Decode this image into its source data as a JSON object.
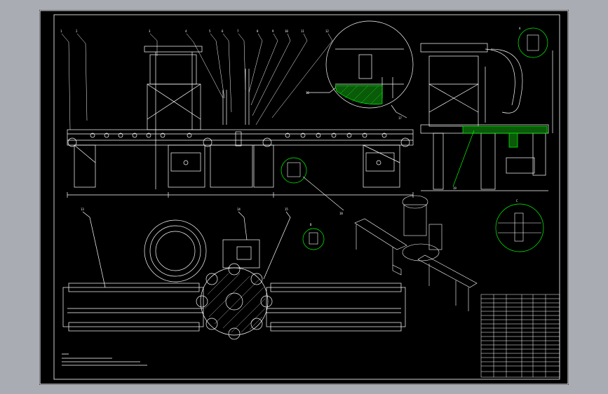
{
  "drawing": {
    "sheet_color": "#000000",
    "background_color": "#a9acb3",
    "line_color": "#ffffff",
    "highlight_color": "#00ff00",
    "part_numbers_top": [
      "1",
      "2",
      "3",
      "4",
      "5",
      "6",
      "7",
      "8",
      "9",
      "10",
      "11",
      "12"
    ],
    "part_numbers_bottom": [
      "13",
      "14",
      "15"
    ],
    "detail_callouts": [
      "16",
      "17",
      "18",
      "19"
    ],
    "zoom_labels": [
      "A",
      "B",
      "C"
    ],
    "title_block_rows": 18
  }
}
